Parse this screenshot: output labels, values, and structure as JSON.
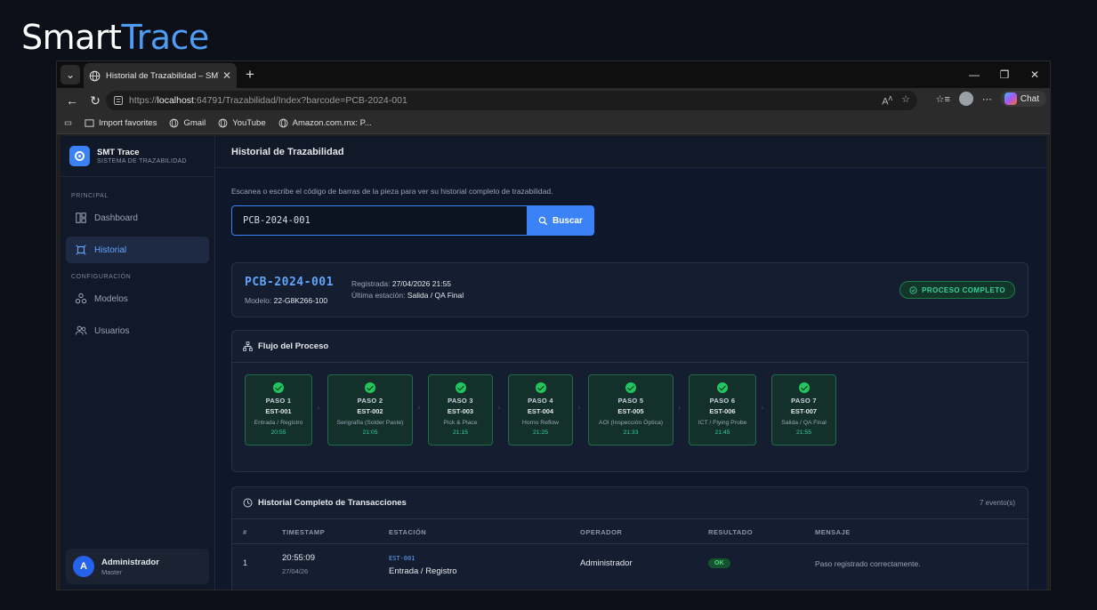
{
  "brand": {
    "part1": "Smart",
    "part2": "Trace"
  },
  "browser": {
    "tab_title": "Historial de Trazabilidad – SMT Tra",
    "url_prefix": "https://",
    "url_host": "localhost",
    "url_rest": ":64791/Trazabilidad/Index?barcode=PCB-2024-001",
    "chat_label": "Chat",
    "bookmarks": [
      "Import favorites",
      "Gmail",
      "YouTube",
      "Amazon.com.mx: P..."
    ]
  },
  "sidebar": {
    "app_name": "SMT Trace",
    "app_sub": "SISTEMA DE TRAZABILIDAD",
    "section_principal": "PRINCIPAL",
    "section_config": "CONFIGURACIÓN",
    "items": [
      {
        "label": "Dashboard",
        "icon": "dashboard-icon"
      },
      {
        "label": "Historial",
        "icon": "history-icon",
        "active": true
      },
      {
        "label": "Modelos",
        "icon": "models-icon"
      },
      {
        "label": "Usuarios",
        "icon": "users-icon"
      }
    ],
    "user": {
      "initial": "A",
      "name": "Administrador",
      "role": "Master"
    }
  },
  "page": {
    "title": "Historial de Trazabilidad",
    "intro": "Escanea o escribe el código de barras de la pieza para ver su historial completo de trazabilidad.",
    "search_value": "PCB-2024-001",
    "search_button": "Buscar"
  },
  "summary": {
    "barcode": "PCB-2024-001",
    "model_label": "Modelo:",
    "model": "22-G8K266-100",
    "registered_label": "Registrada:",
    "registered": "27/04/2026 21:55",
    "last_station_label": "Última estación:",
    "last_station": "Salida / QA Final",
    "status": "PROCESO COMPLETO",
    "status_color": "#34d399"
  },
  "flow": {
    "title": "Flujo del Proceso",
    "steps": [
      {
        "paso": "PASO 1",
        "code": "EST-001",
        "name": "Entrada / Registro",
        "time": "20:55"
      },
      {
        "paso": "PASO 2",
        "code": "EST-002",
        "name": "Serigrafía (Solder Paste)",
        "time": "21:05"
      },
      {
        "paso": "PASO 3",
        "code": "EST-003",
        "name": "Pick & Place",
        "time": "21:15"
      },
      {
        "paso": "PASO 4",
        "code": "EST-004",
        "name": "Horno Reflow",
        "time": "21:25"
      },
      {
        "paso": "PASO 5",
        "code": "EST-005",
        "name": "AOI (Inspección Óptica)",
        "time": "21:33"
      },
      {
        "paso": "PASO 6",
        "code": "EST-006",
        "name": "ICT / Flying Probe",
        "time": "21:45"
      },
      {
        "paso": "PASO 7",
        "code": "EST-007",
        "name": "Salida / QA Final",
        "time": "21:55"
      }
    ]
  },
  "history": {
    "title": "Historial Completo de Transacciones",
    "count": "7 evento(s)",
    "columns": [
      "#",
      "TIMESTAMP",
      "ESTACIÓN",
      "OPERADOR",
      "RESULTADO",
      "MENSAJE"
    ],
    "rows": [
      {
        "idx": "1",
        "time": "20:55:09",
        "date": "27/04/26",
        "code": "EST-001",
        "station": "Entrada / Registro",
        "operator": "Administrador",
        "result": "OK",
        "message": "Paso registrado correctamente."
      }
    ]
  },
  "colors": {
    "accent": "#3b82f6",
    "success": "#22c55e",
    "background": "#0f172a"
  }
}
